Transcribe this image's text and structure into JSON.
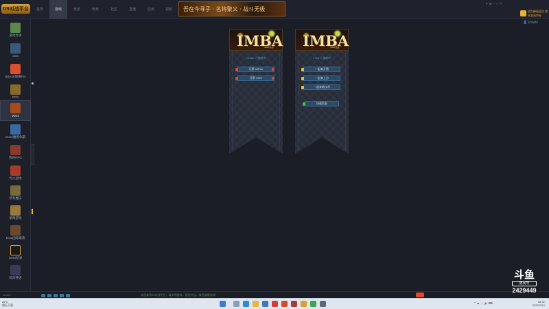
{
  "app": {
    "logo_text": "09对战平台",
    "nav_tabs": [
      "首页",
      "游戏",
      "竞技",
      "电竞",
      "社区",
      "直播",
      "应用",
      "视频"
    ],
    "active_tab_index": 1,
    "banner_text": "吾在今寻子 · 名将聚义 · 战斗无极",
    "window_controls": "♥ ◉ ─ □ ✕",
    "vip_text": "成为峰值会员 尊享超高特权",
    "username": "knwbe"
  },
  "sidebar": {
    "items": [
      {
        "label": "游戏专项",
        "icon": "game-icon",
        "color": "#5a8a4a"
      },
      {
        "label": "dota",
        "icon": "dota-icon",
        "color": "#3a5a7a"
      },
      {
        "label": "NBA2K联赛Pro",
        "icon": "nba-icon",
        "color": "#d8502c"
      },
      {
        "label": "RPG",
        "icon": "rpg-icon",
        "color": "#8a6a2a"
      },
      {
        "label": "War3",
        "icon": "war3-icon",
        "color": "#a84a1a"
      },
      {
        "label": "Dota/魔兽争霸",
        "icon": "dota-war-icon",
        "color": "#3a6aa0"
      },
      {
        "label": "我的RPG",
        "icon": "my-rpg-icon",
        "color": "#8a3a2a"
      },
      {
        "label": "烈火战场",
        "icon": "fire-icon",
        "color": "#a83a2a"
      },
      {
        "label": "所有魔法",
        "icon": "magic-icon",
        "color": "#7a6a3a"
      },
      {
        "label": "策略游戏",
        "icon": "strategy-icon",
        "color": "#9a7a3a"
      },
      {
        "label": "Dota国际邀请",
        "icon": "dota-intl-icon",
        "color": "#6a4a2a"
      },
      {
        "label": "OMG纪录",
        "icon": "omg-icon",
        "color": "#1a1a1a"
      },
      {
        "label": "暗黑神话",
        "icon": "dark-myth-icon",
        "color": "#3a3a5a"
      }
    ],
    "active_index": 4
  },
  "cards": [
    {
      "title": "IMBA",
      "subtitle": "IMBA对抗",
      "room_count": "10946 人游戏中",
      "buttons": [
        "开黑 AllPick",
        "开黑 OMG"
      ]
    },
    {
      "title": "IMBA",
      "subtitle": "IMBA竞技",
      "room_count": "1745 人游戏中",
      "buttons": [
        "一起来开黑",
        "一起来上分",
        "一起来练技术",
        "快速匹配"
      ]
    }
  ],
  "statusbar": {
    "left": "knwbe",
    "notice": "欢迎来到09对战平台，请文明游戏，拒绝外挂，绿色健康游戏！"
  },
  "watermark": {
    "logo": "斗鱼",
    "room_label": "房间号",
    "room_number": "2429449"
  },
  "taskbar": {
    "weather_temp": "26°C",
    "weather_desc": "阴天下雨",
    "time": "18:32",
    "date": "2023/7/14"
  }
}
